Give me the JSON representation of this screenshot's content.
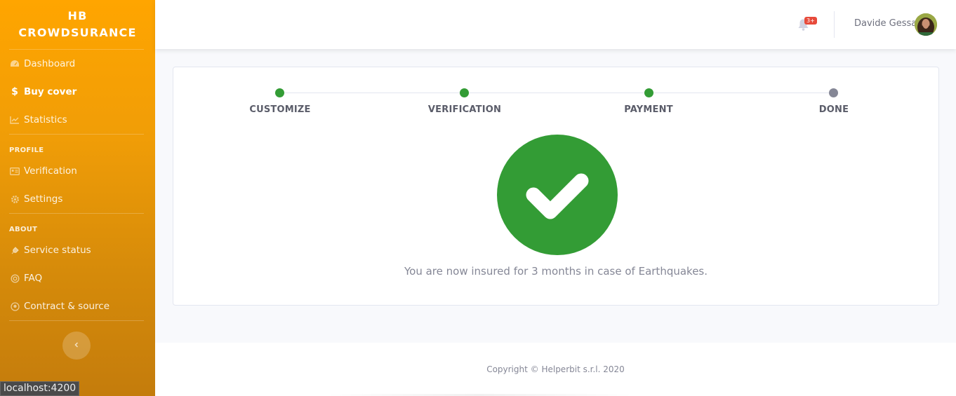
{
  "brand": {
    "line1": "HB",
    "line2": "CROWDSURANCE"
  },
  "sidebar": {
    "items": [
      {
        "label": "Dashboard",
        "icon": "tachometer-icon",
        "active": false
      },
      {
        "label": "Buy cover",
        "icon": "dollar-icon",
        "active": true
      },
      {
        "label": "Statistics",
        "icon": "chart-line-icon",
        "active": false
      }
    ],
    "profile_heading": "PROFILE",
    "profile_items": [
      {
        "label": "Verification",
        "icon": "id-card-icon"
      },
      {
        "label": "Settings",
        "icon": "gear-icon"
      }
    ],
    "about_heading": "ABOUT",
    "about_items": [
      {
        "label": "Service status",
        "icon": "plug-icon"
      },
      {
        "label": "FAQ",
        "icon": "life-ring-icon"
      },
      {
        "label": "Contract & source",
        "icon": "github-icon"
      }
    ],
    "toggle_icon": "chevron-left-icon"
  },
  "topbar": {
    "alerts_badge": "3+",
    "username": "Davide Gessa"
  },
  "stepper": {
    "steps": [
      {
        "label": "CUSTOMIZE",
        "state": "complete"
      },
      {
        "label": "VERIFICATION",
        "state": "complete"
      },
      {
        "label": "PAYMENT",
        "state": "complete"
      },
      {
        "label": "DONE",
        "state": "pending"
      }
    ],
    "complete_color": "#339c35",
    "pending_color": "#858796"
  },
  "result": {
    "message": "You are now insured for 3 months in case of Earthquakes.",
    "icon": "check-icon",
    "color": "#339c35"
  },
  "footer": {
    "copyright": "Copyright © Helperbit s.r.l. 2020"
  },
  "status_url": "localhost:4200"
}
